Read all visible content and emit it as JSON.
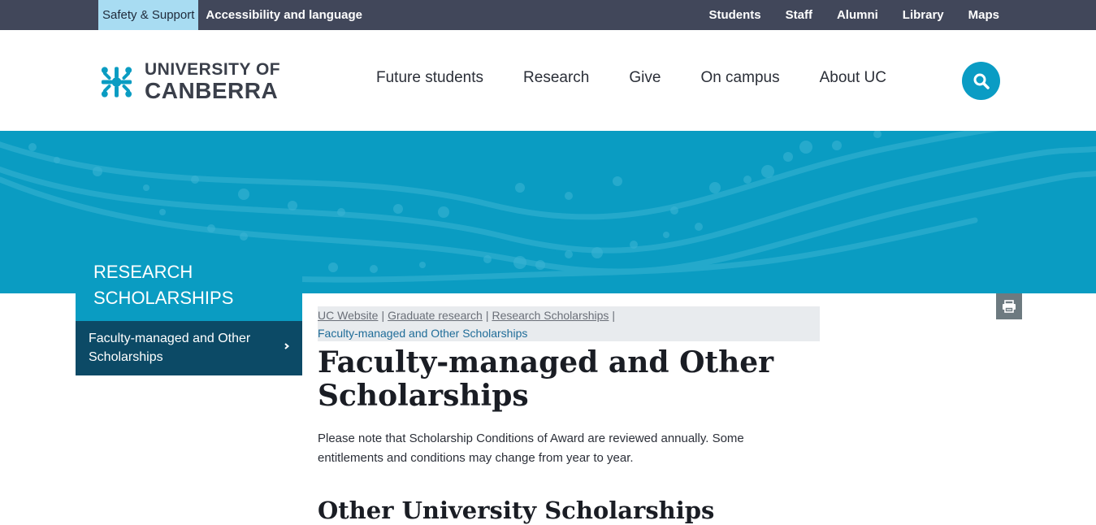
{
  "utility": {
    "safety": "Safety & Support",
    "accessibility": "Accessibility and language",
    "links": [
      "Students",
      "Staff",
      "Alumni",
      "Library",
      "Maps"
    ]
  },
  "logo": {
    "line1": "UNIVERSITY OF",
    "line2": "CANBERRA"
  },
  "nav": [
    "Future students",
    "Research",
    "Give",
    "On campus",
    "About UC"
  ],
  "sidebar": {
    "title": "RESEARCH SCHOLARSHIPS",
    "item": "Faculty-managed and Other Scholarships"
  },
  "breadcrumb": {
    "items": [
      "UC Website",
      "Graduate research",
      "Research Scholarships"
    ],
    "current": "Faculty-managed and Other Scholarships"
  },
  "page": {
    "title": "Faculty-managed and Other Scholarships",
    "intro": "Please note that Scholarship Conditions of Award are reviewed annually. Some entitlements and conditions may change from year to year.",
    "subheading": "Other University Scholarships"
  },
  "colors": {
    "utility_bar": "#41475a",
    "safety_bg": "#a8dcf2",
    "brand_teal": "#0a9cc2",
    "sidebar_dark": "#0c4a66"
  },
  "icons": {
    "search": "search-icon",
    "print": "print-icon",
    "chevron": "chevron-right-icon"
  }
}
